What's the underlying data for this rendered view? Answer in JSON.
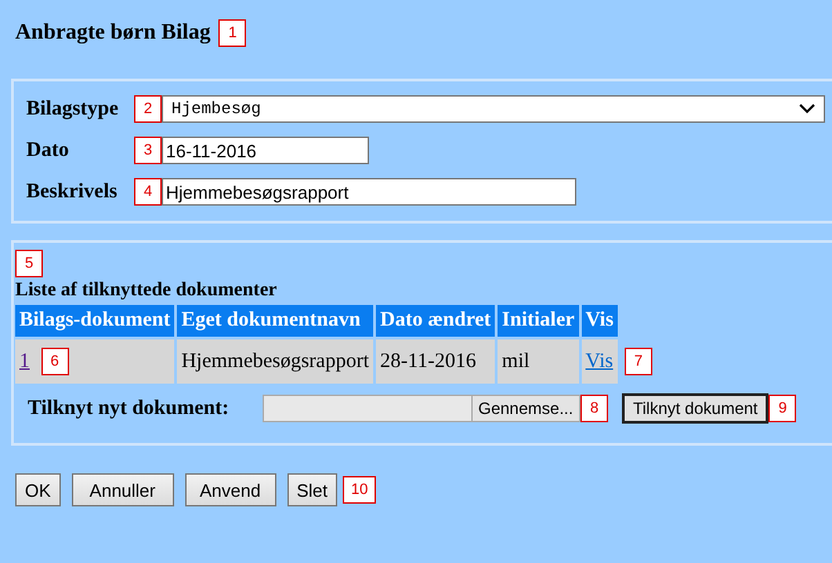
{
  "page": {
    "title": "Anbragte børn Bilag",
    "callout": "1"
  },
  "form": {
    "fields": [
      {
        "kind": "select",
        "label": "Bilagstype",
        "value": "Hjembesøg",
        "callout": "2"
      },
      {
        "kind": "text",
        "label": "Dato",
        "value": "16-11-2016",
        "callout": "3"
      },
      {
        "kind": "text",
        "label": "Beskrivels",
        "value": "Hjemmebesøgsrapport",
        "callout": "4"
      }
    ]
  },
  "documents": {
    "callout": "5",
    "heading": "Liste af tilknyttede dokumenter",
    "columns": [
      "Bilags-dokument",
      "Eget dokumentnavn",
      "Dato ændret",
      "Initialer",
      "Vis"
    ],
    "rows": [
      {
        "number": "1",
        "number_callout": "6",
        "name": "Hjemmebesøgsrapport",
        "date": "28-11-2016",
        "initials": "mil",
        "view": "Vis",
        "view_callout": "7"
      }
    ],
    "attach_label": "Tilknyt nyt dokument:",
    "browse_button": "Gennemse...",
    "browse_callout": "8",
    "attach_button": "Tilknyt dokument",
    "attach_callout": "9"
  },
  "buttons": [
    {
      "label": "OK"
    },
    {
      "label": "Annuller"
    },
    {
      "label": "Anvend"
    },
    {
      "label": "Slet"
    }
  ],
  "buttons_callout": "10"
}
